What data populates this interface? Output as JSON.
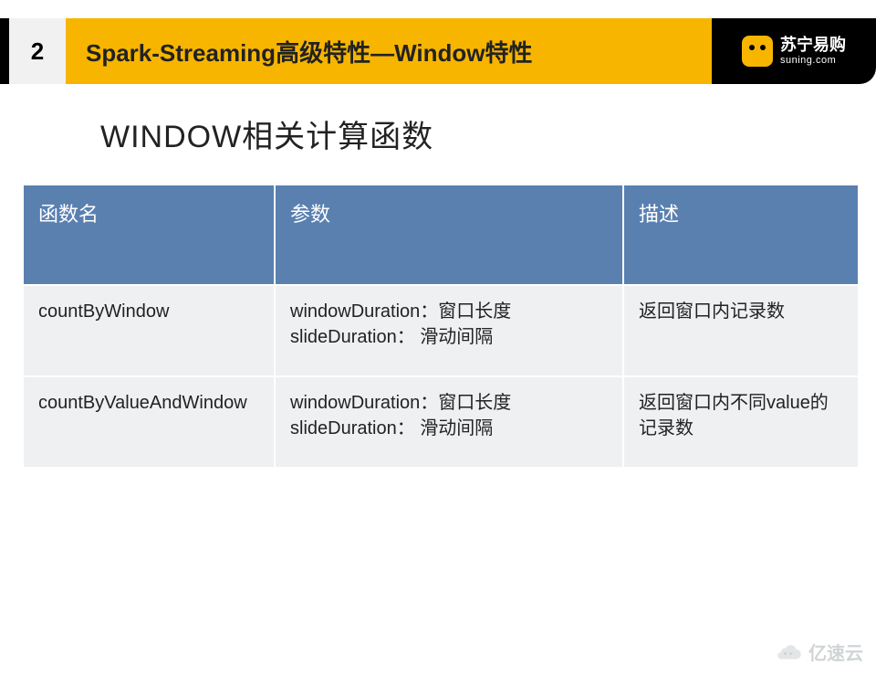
{
  "header": {
    "tab_number": "2",
    "title": "Spark-Streaming高级特性—Window特性",
    "brand_cn": "苏宁易购",
    "brand_en": "suning.com"
  },
  "section_title": "WINDOW相关计算函数",
  "table": {
    "headers": {
      "name": "函数名",
      "param": "参数",
      "desc": "描述"
    },
    "rows": [
      {
        "name": "countByWindow",
        "param": "windowDuration：窗口长度\nslideDuration： 滑动间隔",
        "desc": "返回窗口内记录数"
      },
      {
        "name": "countByValueAndWindow",
        "param": "windowDuration：窗口长度\nslideDuration： 滑动间隔",
        "desc": "返回窗口内不同value的记录数"
      }
    ]
  },
  "watermark": "亿速云"
}
